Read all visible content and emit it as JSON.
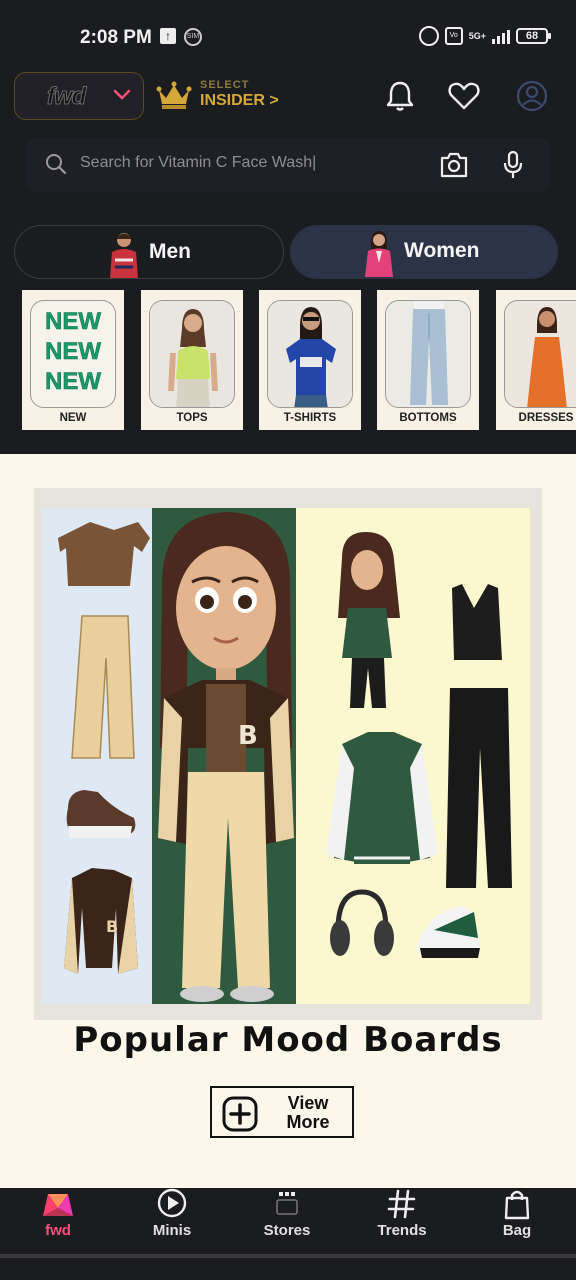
{
  "status_bar": {
    "time": "2:08 PM",
    "network": "5G+",
    "battery": "68"
  },
  "header": {
    "fwd_logo": "fwd",
    "insider_small": "SELECT",
    "insider_label": "INSIDER >"
  },
  "search": {
    "placeholder": "Search for Vitamin C Face Wash|"
  },
  "gender_tabs": [
    {
      "label": "Men",
      "selected": false
    },
    {
      "label": "Women",
      "selected": true
    }
  ],
  "categories": [
    {
      "label": "NEW",
      "tile_text": [
        "NEW",
        "NEW",
        "NEW"
      ]
    },
    {
      "label": "TOPS"
    },
    {
      "label": "T-SHIRTS"
    },
    {
      "label": "BOTTOMS"
    },
    {
      "label": "DRESSES"
    }
  ],
  "mood_board": {
    "title": "Popular Mood Boards",
    "view_more_label_1": "View",
    "view_more_label_2": "More"
  },
  "bottom_nav": [
    {
      "label": "fwd",
      "icon": "myntra-logo-icon",
      "active": true
    },
    {
      "label": "Minis",
      "icon": "play-circle-icon",
      "active": false
    },
    {
      "label": "Stores",
      "icon": "stores-icon",
      "active": false
    },
    {
      "label": "Trends",
      "icon": "hashtag-icon",
      "active": false
    },
    {
      "label": "Bag",
      "icon": "bag-icon",
      "active": false
    }
  ],
  "colors": {
    "background": "#1b1c20",
    "accent_pink": "#ff4f7a",
    "insider_gold": "#d4a93a",
    "content_bg": "#fbf7ea",
    "women_tab": "#2c3346"
  }
}
